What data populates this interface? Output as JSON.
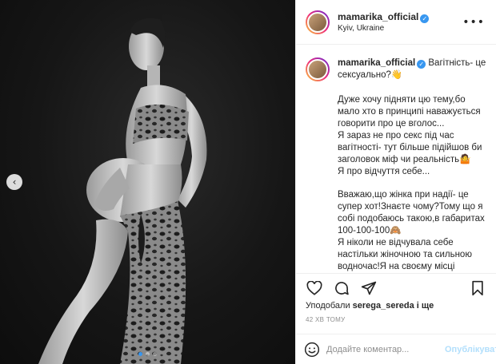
{
  "photo": {
    "prev_icon": "chevron-left-icon",
    "slides_total": 3,
    "slide_active": 1
  },
  "header": {
    "username": "mamarika_official",
    "location": "Kyiv, Ukraine",
    "more_icon": "more-horizontal-icon"
  },
  "caption": {
    "username": "mamarika_official",
    "headline": "Вагітність- це сексуально?👋",
    "paragraph1": "Дуже хочу підняти цю тему,бо мало хто в принципі наважується говорити про це вголос...",
    "paragraph2": "Я зараз не про секс під час вагітності- тут більше підійшов би заголовок міф чи реальність🤷",
    "paragraph3": "Я про відчуття себе...",
    "paragraph4": "Вважаю,що жінка при надії- це супер хот!Знаєте чому?Тому що я собі подобаюсь такою,в габаритах 100-100-100🙈",
    "paragraph5": "Я ніколи не відчувала себе настільки жіночною та сильною водночас!Я на своєму місці більше ніж коли-небудь!"
  },
  "actions": {
    "like_icon": "heart-icon",
    "comment_icon": "comment-icon",
    "share_icon": "paper-plane-icon",
    "save_icon": "bookmark-icon"
  },
  "likes": {
    "prefix": "Уподобали ",
    "user": "serega_sereda",
    "suffix": " і ще"
  },
  "time": "42 ХВ ТОМУ",
  "comment": {
    "placeholder": "Додайте коментар...",
    "post_label": "Опублікувати",
    "post_color": "#b2dffc"
  },
  "colors": {
    "verified": "#3897f0",
    "muted": "#8e8e8e",
    "text": "#262626"
  }
}
